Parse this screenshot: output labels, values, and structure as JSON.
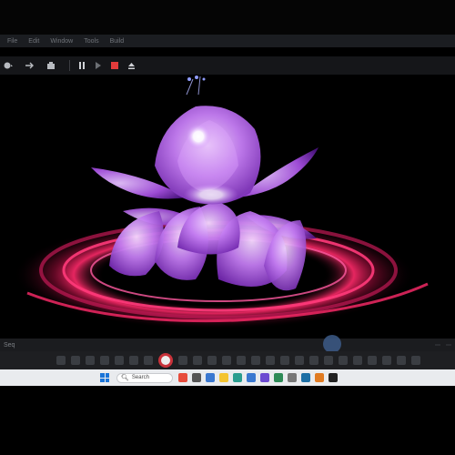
{
  "window": {
    "menu_items": [
      "File",
      "Edit",
      "Window",
      "Tools",
      "Build"
    ],
    "menu_right": "",
    "accent_color": "#e0227f"
  },
  "toolbar": {
    "icons": [
      "camera-mode-icon",
      "transform-icon",
      "build-icon",
      "pause-icon",
      "play-icon",
      "stop-icon",
      "eject-icon"
    ]
  },
  "viewport": {
    "scene": "glowing purple lotus flower over red energy rings",
    "flower_color": "#b565e8",
    "ring_color": "#ff2a6a"
  },
  "timeline": {
    "label": "Seq",
    "right_tabs": [
      "",
      ""
    ],
    "playhead_fraction": 0.73
  },
  "taskbar": {
    "search_label": "Search",
    "app_colors": [
      "#e74c3c",
      "#555",
      "#3a78d0",
      "#f4c430",
      "#2a9d8f",
      "#3a78d0",
      "#6c4bd1",
      "#2e8b57",
      "#777",
      "#1d6fa5",
      "#e07b22",
      "#222"
    ]
  }
}
